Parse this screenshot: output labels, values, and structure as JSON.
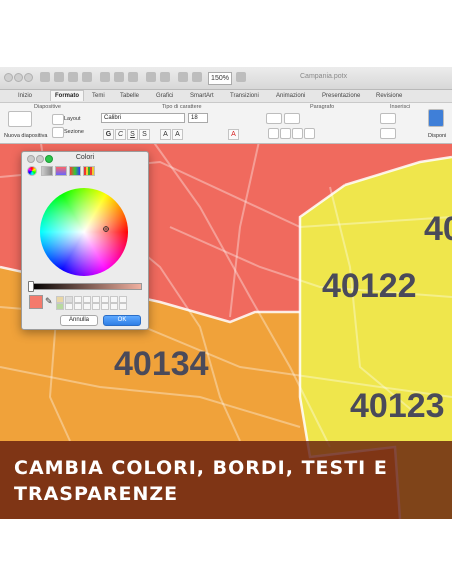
{
  "window": {
    "title": "Campania.potx",
    "zoom": "150%"
  },
  "ribbon_tabs": [
    "Inizio",
    "Formato",
    "Temi",
    "Tabelle",
    "Grafici",
    "SmartArt",
    "Transizioni",
    "Animazioni",
    "Presentazione",
    "Revisione"
  ],
  "ribbon": {
    "groups": {
      "diapositive": "Diapositive",
      "carattere": "Tipo di carattere",
      "paragrafo": "Paragrafo",
      "inserisci": "Inserisci"
    },
    "new_slide": "Nuova diapositiva",
    "layout": "Layout",
    "sezione": "Sezione",
    "font_name": "Calibri",
    "font_size": "18",
    "disponi": "Disponi"
  },
  "color_picker": {
    "title": "Colori",
    "cancel_label": "Annulla",
    "ok_label": "OK",
    "selected_color": "#f47a6c"
  },
  "map": {
    "zones": [
      {
        "code": "40122",
        "color": "#f2e84a"
      },
      {
        "code": "40134",
        "color": "#f0a23a"
      },
      {
        "code": "40123",
        "color": "#f2e84a"
      },
      {
        "code": "40",
        "color": "#f2e84a"
      }
    ],
    "red_zone_color": "#f06a5e"
  },
  "banner": {
    "text": "CAMBIA COLORI, BORDI, TESTI E TRASPARENZE"
  }
}
